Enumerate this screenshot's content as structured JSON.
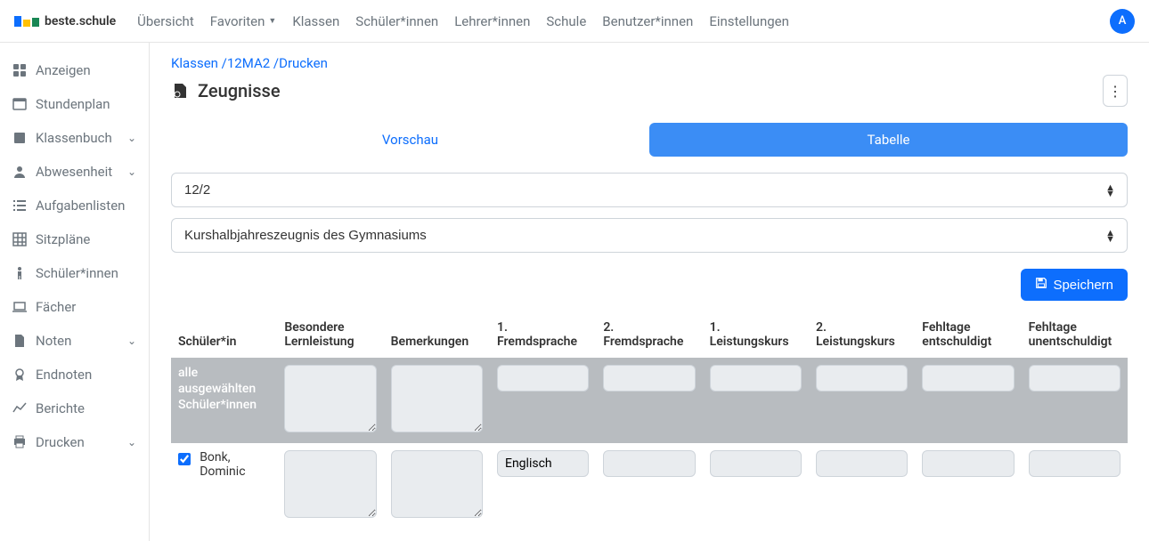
{
  "brand": "beste.schule",
  "topnav": {
    "overview": "Übersicht",
    "favorites": "Favoriten",
    "classes": "Klassen",
    "students": "Schüler*innen",
    "teachers": "Lehrer*innen",
    "school": "Schule",
    "users": "Benutzer*innen",
    "settings": "Einstellungen"
  },
  "avatar_initial": "A",
  "sidebar": {
    "anzeigen": "Anzeigen",
    "stundenplan": "Stundenplan",
    "klassenbuch": "Klassenbuch",
    "abwesenheit": "Abwesenheit",
    "aufgabenlisten": "Aufgabenlisten",
    "sitzplaene": "Sitzpläne",
    "schueler": "Schüler*innen",
    "faecher": "Fächer",
    "noten": "Noten",
    "endnoten": "Endnoten",
    "berichte": "Berichte",
    "drucken": "Drucken"
  },
  "breadcrumb": {
    "c1": "Klassen",
    "c2": "12MA2",
    "c3": "Drucken"
  },
  "page_title": "Zeugnisse",
  "tabs": {
    "preview": "Vorschau",
    "table": "Tabelle"
  },
  "selects": {
    "period": "12/2",
    "report_type": "Kurshalbjahreszeugnis des Gymnasiums"
  },
  "save_label": "Speichern",
  "columns": {
    "student": "Schüler*in",
    "besondere": "Besondere Lernleistung",
    "bemerkungen": "Bemerkungen",
    "fs1": "1. Fremdsprache",
    "fs2": "2. Fremdsprache",
    "lk1": "1. Leistungskurs",
    "lk2": "2. Leistungskurs",
    "fe": "Fehltage entschuldigt",
    "fu": "Fehltage unentschuldigt"
  },
  "allrow_label": "alle ausgewählten Schüler*innen",
  "rows": [
    {
      "name": "Bonk, Dominic",
      "checked": true,
      "besondere": "",
      "bemerkungen": "",
      "fs1": "Englisch",
      "fs2": "",
      "lk1": "",
      "lk2": "",
      "fe": "",
      "fu": ""
    }
  ]
}
